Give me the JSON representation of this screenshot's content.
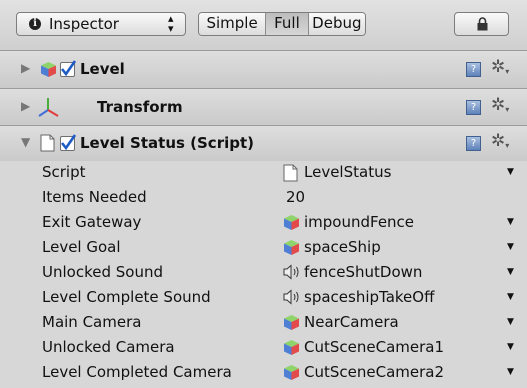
{
  "toolbar": {
    "panel_selector_label": "Inspector",
    "modes": [
      "Simple",
      "Full",
      "Debug"
    ],
    "active_mode": "Full"
  },
  "components": {
    "level": {
      "name": "Level",
      "enabled": true
    },
    "transform": {
      "name": "Transform"
    },
    "level_status": {
      "name": "Level Status (Script)",
      "enabled": true,
      "expanded": true
    }
  },
  "properties": [
    {
      "label": "Script",
      "value": "LevelStatus",
      "icon": "script-file-icon",
      "has_dropdown": true
    },
    {
      "label": "Items Needed",
      "value": "20",
      "icon": "",
      "has_dropdown": false
    },
    {
      "label": "Exit Gateway",
      "value": "impoundFence",
      "icon": "prefab-cube-icon",
      "has_dropdown": true
    },
    {
      "label": "Level Goal",
      "value": "spaceShip",
      "icon": "prefab-cube-icon",
      "has_dropdown": true
    },
    {
      "label": "Unlocked Sound",
      "value": "fenceShutDown",
      "icon": "audio-clip-icon",
      "has_dropdown": true
    },
    {
      "label": "Level Complete Sound",
      "value": "spaceshipTakeOff",
      "icon": "audio-clip-icon",
      "has_dropdown": true
    },
    {
      "label": "Main Camera",
      "value": "NearCamera",
      "icon": "prefab-cube-icon",
      "has_dropdown": true
    },
    {
      "label": "Unlocked Camera",
      "value": "CutSceneCamera1",
      "icon": "prefab-cube-icon",
      "has_dropdown": true
    },
    {
      "label": "Level Completed Camera",
      "value": "CutSceneCamera2",
      "icon": "prefab-cube-icon",
      "has_dropdown": true
    }
  ],
  "colors": {
    "panel_bg": "#d2d2d2",
    "header_bg": "#d4d4d4",
    "book_icon": "#6f8fc4"
  }
}
